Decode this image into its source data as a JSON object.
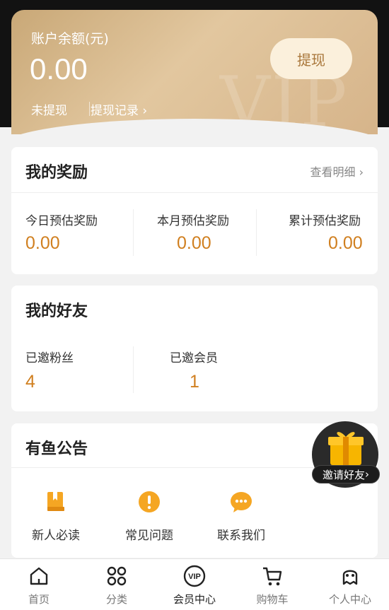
{
  "balance": {
    "label": "账户余额(元)",
    "amount": "0.00",
    "withdraw_button": "提现",
    "not_withdrawn": "未提现",
    "withdraw_history": "提现记录",
    "watermark": "VIP"
  },
  "rewards": {
    "title": "我的奖励",
    "view_detail": "查看明细",
    "items": [
      {
        "label": "今日预估奖励",
        "value": "0.00"
      },
      {
        "label": "本月预估奖励",
        "value": "0.00"
      },
      {
        "label": "累计预估奖励",
        "value": "0.00"
      }
    ]
  },
  "friends": {
    "title": "我的好友",
    "items": [
      {
        "label": "已邀粉丝",
        "value": "4"
      },
      {
        "label": "已邀会员",
        "value": "1"
      }
    ]
  },
  "notice": {
    "title": "有鱼公告",
    "items": [
      {
        "label": "新人必读",
        "icon": "book-icon"
      },
      {
        "label": "常见问题",
        "icon": "exclamation-icon"
      },
      {
        "label": "联系我们",
        "icon": "chat-icon"
      }
    ]
  },
  "invite": {
    "label": "邀请好友"
  },
  "tabbar": {
    "items": [
      {
        "label": "首页",
        "icon": "home-icon"
      },
      {
        "label": "分类",
        "icon": "category-icon"
      },
      {
        "label": "会员中心",
        "icon": "vip-icon",
        "active": true
      },
      {
        "label": "购物车",
        "icon": "cart-icon"
      },
      {
        "label": "个人中心",
        "icon": "profile-icon"
      }
    ]
  },
  "colors": {
    "accent": "#d07f1f",
    "gold": "#e2c79f",
    "icon_orange": "#f5a623"
  }
}
